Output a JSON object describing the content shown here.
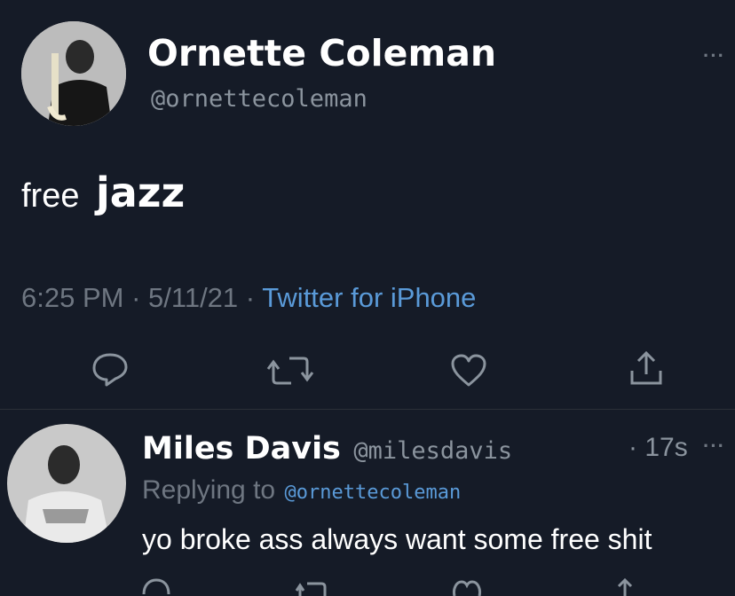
{
  "tweet": {
    "author": {
      "name": "Ornette Coleman",
      "handle": "@ornettecoleman"
    },
    "text": {
      "word1": "free",
      "word2": "jazz"
    },
    "meta": {
      "time": "6:25 PM",
      "sep1": "·",
      "date": "5/11/21",
      "sep2": "·",
      "source": "Twitter for iPhone"
    },
    "actions": [
      "reply-icon",
      "retweet-icon",
      "like-icon",
      "share-icon"
    ]
  },
  "reply": {
    "author": {
      "name": "Miles Davis",
      "handle": "@milesdavis"
    },
    "time": "· 17s",
    "replying_label": "Replying to",
    "replying_handle": "@ornettecoleman",
    "text": "yo broke ass always want some free shit"
  },
  "more_label": "···",
  "colors": {
    "background": "#151b27",
    "link": "#5a9ad8",
    "muted": "#6e7681"
  }
}
